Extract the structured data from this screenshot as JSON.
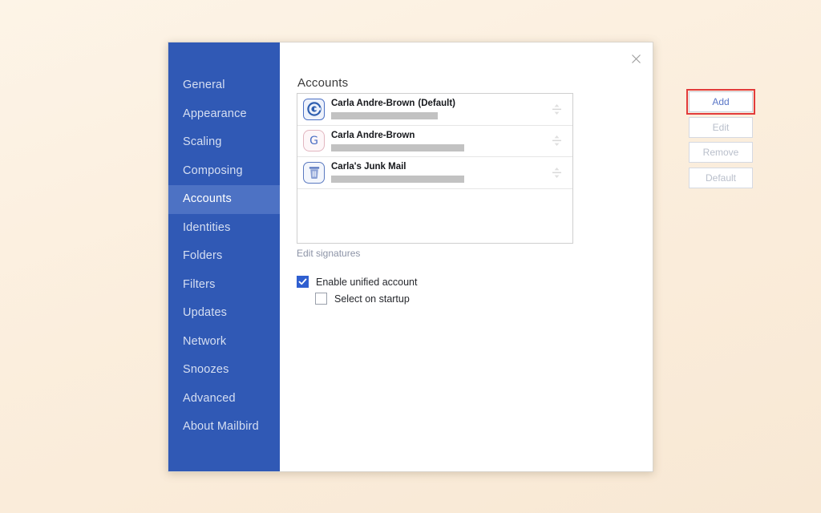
{
  "window": {
    "close_icon": "close-icon"
  },
  "sidebar": {
    "items": [
      {
        "label": "General",
        "selected": false
      },
      {
        "label": "Appearance",
        "selected": false
      },
      {
        "label": "Scaling",
        "selected": false
      },
      {
        "label": "Composing",
        "selected": false
      },
      {
        "label": "Accounts",
        "selected": true
      },
      {
        "label": "Identities",
        "selected": false
      },
      {
        "label": "Folders",
        "selected": false
      },
      {
        "label": "Filters",
        "selected": false
      },
      {
        "label": "Updates",
        "selected": false
      },
      {
        "label": "Network",
        "selected": false
      },
      {
        "label": "Snoozes",
        "selected": false
      },
      {
        "label": "Advanced",
        "selected": false
      },
      {
        "label": "About Mailbird",
        "selected": false
      }
    ]
  },
  "main": {
    "title": "Accounts",
    "accounts": [
      {
        "name": "Carla Andre-Brown",
        "default_tag": "(Default)",
        "email_redacted": true,
        "redacted_width": 133,
        "icon": "outlook-icon",
        "handle": "reorder-handle-icon"
      },
      {
        "name": "Carla Andre-Brown",
        "default_tag": "",
        "email_redacted": true,
        "redacted_width": 166,
        "icon": "google-icon",
        "handle": "reorder-handle-icon"
      },
      {
        "name": "Carla's Junk Mail",
        "default_tag": "",
        "email_redacted": true,
        "redacted_width": 166,
        "icon": "trash-icon",
        "handle": "reorder-handle-icon"
      }
    ],
    "buttons": [
      {
        "label": "Add",
        "enabled": true,
        "highlighted": true
      },
      {
        "label": "Edit",
        "enabled": false,
        "highlighted": false
      },
      {
        "label": "Remove",
        "enabled": false,
        "highlighted": false
      },
      {
        "label": "Default",
        "enabled": false,
        "highlighted": false
      }
    ],
    "edit_signatures_link": "Edit signatures",
    "checkboxes": [
      {
        "label": "Enable unified account",
        "checked": true
      },
      {
        "label": "Select on startup",
        "checked": false
      }
    ]
  },
  "colors": {
    "sidebar_bg": "#3059b5",
    "sidebar_selected": "#4d72c4",
    "page_bg": "#fbf0e0",
    "accent_link": "#5b77c7",
    "highlight_border": "#e23b3b",
    "checkbox_checked": "#2f5fd0"
  }
}
